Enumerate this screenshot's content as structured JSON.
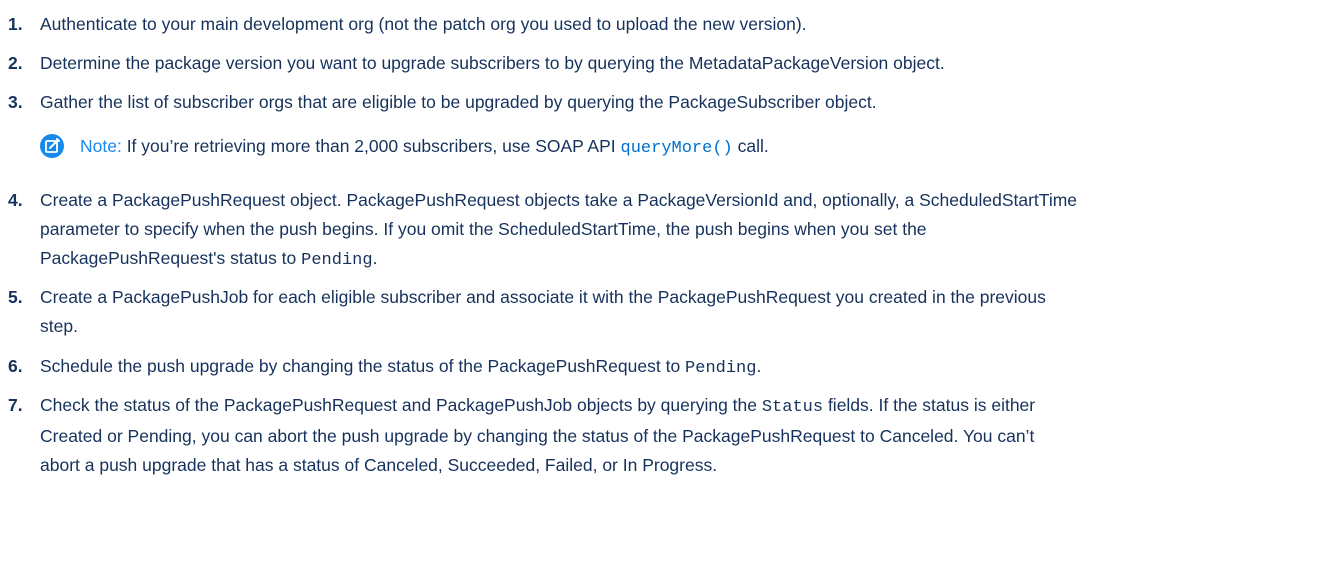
{
  "steps": [
    {
      "num": "1.",
      "text": "Authenticate to your main development org (not the patch org you used to upload the new version)."
    },
    {
      "num": "2.",
      "text": "Determine the package version you want to upgrade subscribers to by querying the MetadataPackageVersion object."
    },
    {
      "num": "3.",
      "text": "Gather the list of subscriber orgs that are eligible to be upgraded by querying the PackageSubscriber object."
    },
    {
      "num": "4.",
      "line1": "Create a PackagePushRequest object. PackagePushRequest objects take a PackageVersionId and, optionally, a ScheduledStartTime",
      "line2": "parameter to specify when the push begins. If you omit the ScheduledStartTime, the push begins when you set the",
      "line3a": "PackagePushRequest's status to ",
      "line3code": "Pending",
      "line3b": "."
    },
    {
      "num": "5.",
      "line1": "Create a PackagePushJob for each eligible subscriber and associate it with the PackagePushRequest you created in the previous",
      "line2": "step."
    },
    {
      "num": "6.",
      "texta": "Schedule the push upgrade by changing the status of the PackagePushRequest to ",
      "code": "Pending",
      "textb": "."
    },
    {
      "num": "7.",
      "line1a": "Check the status of the PackagePushRequest and PackagePushJob objects by querying the ",
      "line1code": "Status",
      "line1b": " fields. If the status is either",
      "line2": "Created or Pending, you can abort the push upgrade by changing the status of the PackagePushRequest to Canceled. You can’t",
      "line3": "abort a push upgrade that has a status of Canceled, Succeeded, Failed, or In Progress."
    }
  ],
  "note": {
    "label": "Note:",
    "text_before": " If you’re retrieving more than 2,000 subscribers, use SOAP API ",
    "code": "queryMore()",
    "text_after": " call.",
    "icon": "edit-note-icon"
  },
  "colors": {
    "text": "#16325c",
    "accent": "#1589ee",
    "link": "#0070d2"
  }
}
